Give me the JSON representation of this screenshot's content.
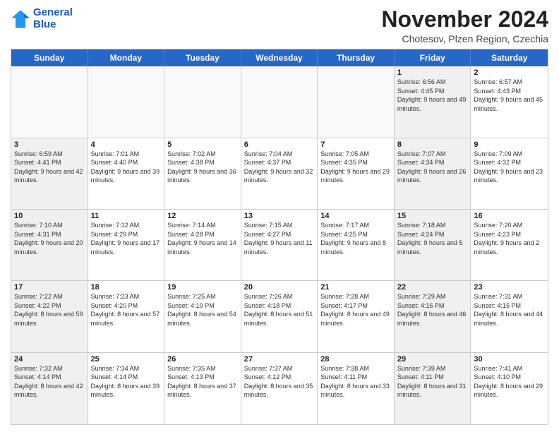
{
  "header": {
    "logo_line1": "General",
    "logo_line2": "Blue",
    "month_title": "November 2024",
    "location": "Chotesov, Plzen Region, Czechia"
  },
  "days_of_week": [
    "Sunday",
    "Monday",
    "Tuesday",
    "Wednesday",
    "Thursday",
    "Friday",
    "Saturday"
  ],
  "weeks": [
    [
      {
        "day": "",
        "info": "",
        "empty": true
      },
      {
        "day": "",
        "info": "",
        "empty": true
      },
      {
        "day": "",
        "info": "",
        "empty": true
      },
      {
        "day": "",
        "info": "",
        "empty": true
      },
      {
        "day": "",
        "info": "",
        "empty": true
      },
      {
        "day": "1",
        "info": "Sunrise: 6:56 AM\nSunset: 4:45 PM\nDaylight: 9 hours and 49 minutes.",
        "shaded": true
      },
      {
        "day": "2",
        "info": "Sunrise: 6:57 AM\nSunset: 4:43 PM\nDaylight: 9 hours and 45 minutes."
      }
    ],
    [
      {
        "day": "3",
        "info": "Sunrise: 6:59 AM\nSunset: 4:41 PM\nDaylight: 9 hours and 42 minutes.",
        "shaded": true
      },
      {
        "day": "4",
        "info": "Sunrise: 7:01 AM\nSunset: 4:40 PM\nDaylight: 9 hours and 39 minutes."
      },
      {
        "day": "5",
        "info": "Sunrise: 7:02 AM\nSunset: 4:38 PM\nDaylight: 9 hours and 36 minutes."
      },
      {
        "day": "6",
        "info": "Sunrise: 7:04 AM\nSunset: 4:37 PM\nDaylight: 9 hours and 32 minutes."
      },
      {
        "day": "7",
        "info": "Sunrise: 7:05 AM\nSunset: 4:35 PM\nDaylight: 9 hours and 29 minutes."
      },
      {
        "day": "8",
        "info": "Sunrise: 7:07 AM\nSunset: 4:34 PM\nDaylight: 9 hours and 26 minutes.",
        "shaded": true
      },
      {
        "day": "9",
        "info": "Sunrise: 7:09 AM\nSunset: 4:32 PM\nDaylight: 9 hours and 23 minutes."
      }
    ],
    [
      {
        "day": "10",
        "info": "Sunrise: 7:10 AM\nSunset: 4:31 PM\nDaylight: 9 hours and 20 minutes.",
        "shaded": true
      },
      {
        "day": "11",
        "info": "Sunrise: 7:12 AM\nSunset: 4:29 PM\nDaylight: 9 hours and 17 minutes."
      },
      {
        "day": "12",
        "info": "Sunrise: 7:14 AM\nSunset: 4:28 PM\nDaylight: 9 hours and 14 minutes."
      },
      {
        "day": "13",
        "info": "Sunrise: 7:15 AM\nSunset: 4:27 PM\nDaylight: 9 hours and 11 minutes."
      },
      {
        "day": "14",
        "info": "Sunrise: 7:17 AM\nSunset: 4:25 PM\nDaylight: 9 hours and 8 minutes."
      },
      {
        "day": "15",
        "info": "Sunrise: 7:18 AM\nSunset: 4:24 PM\nDaylight: 9 hours and 5 minutes.",
        "shaded": true
      },
      {
        "day": "16",
        "info": "Sunrise: 7:20 AM\nSunset: 4:23 PM\nDaylight: 9 hours and 2 minutes."
      }
    ],
    [
      {
        "day": "17",
        "info": "Sunrise: 7:22 AM\nSunset: 4:22 PM\nDaylight: 8 hours and 59 minutes.",
        "shaded": true
      },
      {
        "day": "18",
        "info": "Sunrise: 7:23 AM\nSunset: 4:20 PM\nDaylight: 8 hours and 57 minutes."
      },
      {
        "day": "19",
        "info": "Sunrise: 7:25 AM\nSunset: 4:19 PM\nDaylight: 8 hours and 54 minutes."
      },
      {
        "day": "20",
        "info": "Sunrise: 7:26 AM\nSunset: 4:18 PM\nDaylight: 8 hours and 51 minutes."
      },
      {
        "day": "21",
        "info": "Sunrise: 7:28 AM\nSunset: 4:17 PM\nDaylight: 8 hours and 49 minutes."
      },
      {
        "day": "22",
        "info": "Sunrise: 7:29 AM\nSunset: 4:16 PM\nDaylight: 8 hours and 46 minutes.",
        "shaded": true
      },
      {
        "day": "23",
        "info": "Sunrise: 7:31 AM\nSunset: 4:15 PM\nDaylight: 8 hours and 44 minutes."
      }
    ],
    [
      {
        "day": "24",
        "info": "Sunrise: 7:32 AM\nSunset: 4:14 PM\nDaylight: 8 hours and 42 minutes.",
        "shaded": true
      },
      {
        "day": "25",
        "info": "Sunrise: 7:34 AM\nSunset: 4:14 PM\nDaylight: 8 hours and 39 minutes."
      },
      {
        "day": "26",
        "info": "Sunrise: 7:35 AM\nSunset: 4:13 PM\nDaylight: 8 hours and 37 minutes."
      },
      {
        "day": "27",
        "info": "Sunrise: 7:37 AM\nSunset: 4:12 PM\nDaylight: 8 hours and 35 minutes."
      },
      {
        "day": "28",
        "info": "Sunrise: 7:38 AM\nSunset: 4:11 PM\nDaylight: 8 hours and 33 minutes."
      },
      {
        "day": "29",
        "info": "Sunrise: 7:39 AM\nSunset: 4:11 PM\nDaylight: 8 hours and 31 minutes.",
        "shaded": true
      },
      {
        "day": "30",
        "info": "Sunrise: 7:41 AM\nSunset: 4:10 PM\nDaylight: 8 hours and 29 minutes."
      }
    ]
  ]
}
